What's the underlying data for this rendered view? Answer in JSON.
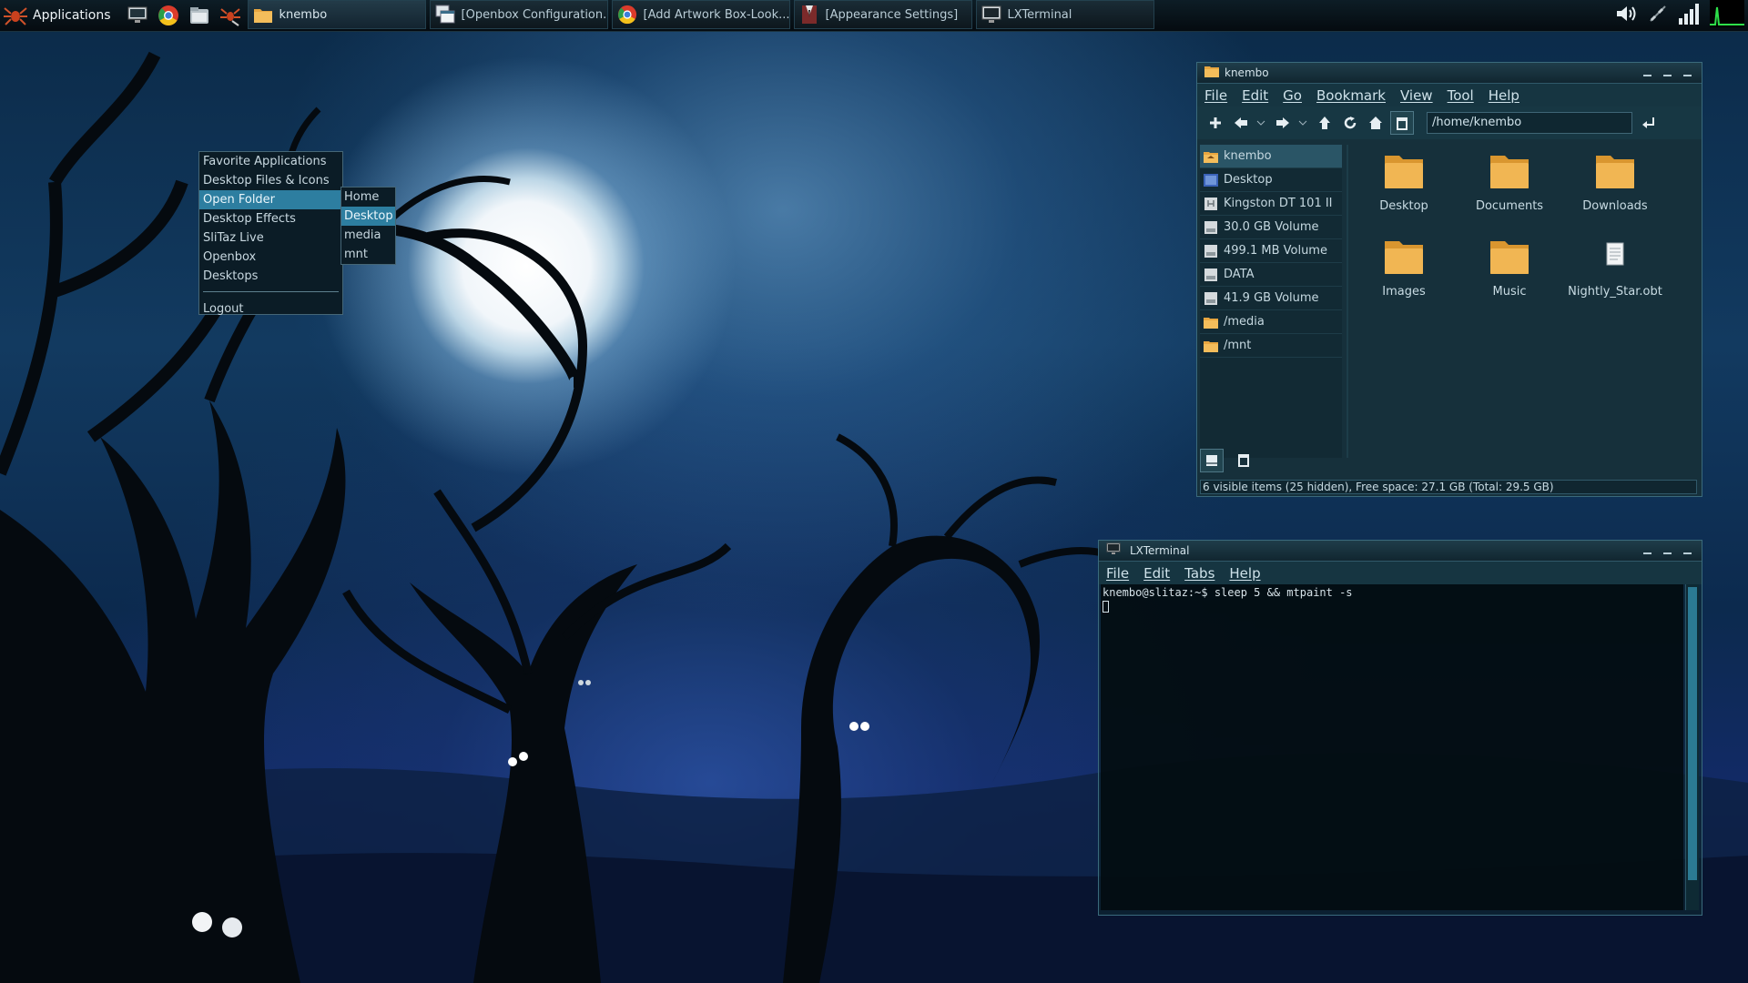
{
  "colors": {
    "accent": "#2d7ea0",
    "panel": "#16303b",
    "border": "#3a6a7c",
    "selection": "#2a5566"
  },
  "taskbar": {
    "apps_label": "Applications",
    "quick_launch": [
      {
        "icon": "monitor-icon"
      },
      {
        "icon": "chrome-icon"
      },
      {
        "icon": "file-manager-icon"
      },
      {
        "icon": "spider-tools-icon"
      }
    ],
    "tasks": [
      {
        "label": "knembo",
        "icon": "folder-icon"
      },
      {
        "label": "[Openbox Configuration...",
        "icon": "window-icon"
      },
      {
        "label": "[Add Artwork Box-Look...",
        "icon": "chrome-icon"
      },
      {
        "label": "[Appearance Settings]",
        "icon": "appearance-icon"
      },
      {
        "label": "LXTerminal",
        "icon": "terminal-icon"
      }
    ],
    "tray": [
      "volume-icon",
      "network-icon",
      "signal-icon",
      "cpu-graph-icon"
    ]
  },
  "desktop_menu": {
    "items": [
      {
        "label": "Favorite Applications"
      },
      {
        "label": "Desktop Files & Icons"
      },
      {
        "label": "Open Folder"
      },
      {
        "label": "Desktop Effects"
      },
      {
        "label": "SliTaz Live"
      },
      {
        "label": "Openbox"
      },
      {
        "label": "Desktops"
      }
    ],
    "logout": "Logout",
    "submenu": [
      "Home",
      "Desktop",
      "media",
      "mnt"
    ]
  },
  "file_manager": {
    "title": "knembo",
    "menu": [
      "File",
      "Edit",
      "Go",
      "Bookmark",
      "View",
      "Tool",
      "Help"
    ],
    "path": "/home/knembo",
    "sidebar": [
      "knembo",
      "Desktop",
      "Kingston DT 101 II",
      "30.0 GB Volume",
      "499.1 MB Volume",
      "DATA",
      "41.9 GB Volume",
      "/media",
      "/mnt"
    ],
    "files": [
      "Desktop",
      "Documents",
      "Downloads",
      "Images",
      "Music",
      "Nightly_Star.obt"
    ],
    "status": "6 visible items (25 hidden), Free space: 27.1 GB (Total: 29.5 GB)"
  },
  "terminal": {
    "title": "LXTerminal",
    "menu": [
      "File",
      "Edit",
      "Tabs",
      "Help"
    ],
    "line": "knembo@slitaz:~$ sleep 5  && mtpaint -s"
  }
}
